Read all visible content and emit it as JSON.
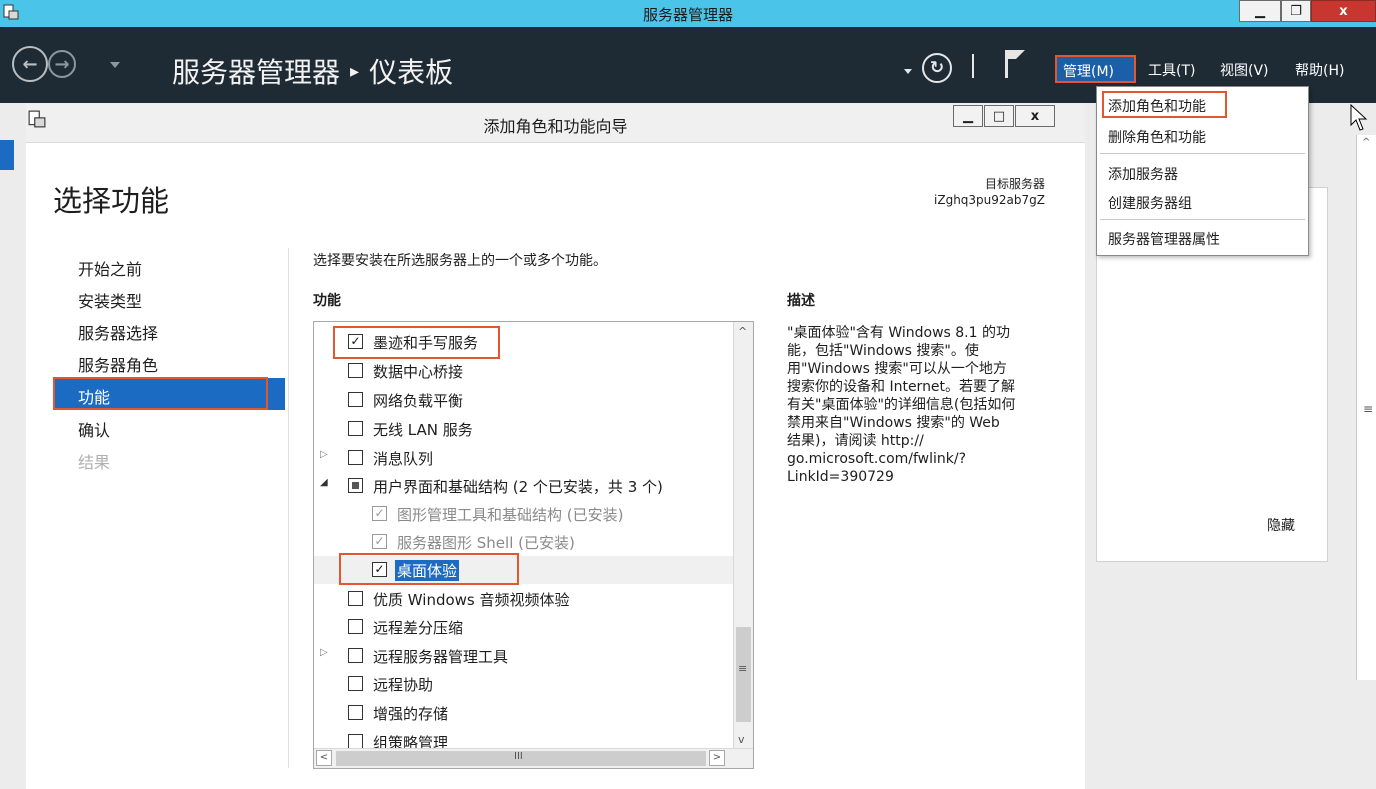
{
  "window": {
    "title": "服务器管理器",
    "minimize": "▁",
    "restore": "❐",
    "close": "x"
  },
  "header": {
    "breadcrumb_root": "服务器管理器",
    "breadcrumb_separator": "▸",
    "breadcrumb_current": "仪表板",
    "menus": {
      "manage": "管理(M)",
      "tools": "工具(T)",
      "view": "视图(V)",
      "help": "帮助(H)"
    }
  },
  "manage_menu": {
    "items": [
      "添加角色和功能",
      "删除角色和功能",
      "添加服务器",
      "创建服务器组",
      "服务器管理器属性"
    ]
  },
  "dialog": {
    "title": "添加角色和功能向导",
    "heading": "选择功能",
    "target_label": "目标服务器",
    "target_server": "iZghq3pu92ab7gZ",
    "steps": [
      "开始之前",
      "安装类型",
      "服务器选择",
      "服务器角色",
      "功能",
      "确认",
      "结果"
    ],
    "active_step": "功能",
    "intro": "选择要安装在所选服务器上的一个或多个功能。",
    "features_header": "功能",
    "description_header": "描述",
    "features": [
      {
        "label": "墨迹和手写服务",
        "state": "checked"
      },
      {
        "label": "数据中心桥接",
        "state": "unchecked"
      },
      {
        "label": "网络负载平衡",
        "state": "unchecked"
      },
      {
        "label": "无线 LAN 服务",
        "state": "unchecked"
      },
      {
        "label": "消息队列",
        "state": "unchecked",
        "expander": "collapsed"
      },
      {
        "label": "用户界面和基础结构 (2 个已安装，共 3 个)",
        "state": "partial",
        "expander": "expanded"
      },
      {
        "label": "图形管理工具和基础结构 (已安装)",
        "state": "installed"
      },
      {
        "label": "服务器图形 Shell (已安装)",
        "state": "installed"
      },
      {
        "label": "桌面体验",
        "state": "checked",
        "selected": true
      },
      {
        "label": "优质 Windows 音频视频体验",
        "state": "unchecked"
      },
      {
        "label": "远程差分压缩",
        "state": "unchecked"
      },
      {
        "label": "远程服务器管理工具",
        "state": "unchecked",
        "expander": "collapsed"
      },
      {
        "label": "远程协助",
        "state": "unchecked"
      },
      {
        "label": "增强的存储",
        "state": "unchecked"
      },
      {
        "label": "组策略管理",
        "state": "unchecked"
      }
    ],
    "description_lines": [
      "\"桌面体验\"含有 Windows 8.1 的功",
      "能，包括\"Windows 搜索\"。使",
      "用\"Windows 搜索\"可以从一个地方",
      "搜索你的设备和 Internet。若要了解",
      "有关\"桌面体验\"的详细信息(包括如何",
      "禁用来自\"Windows 搜索\"的 Web",
      "结果)，请阅读 http://",
      "go.microsoft.com/fwlink/?",
      "LinkId=390729"
    ]
  },
  "right_panel": {
    "hide_label": "隐藏"
  },
  "colors": {
    "title_bar": "#4bc4ea",
    "header_bg": "#1f2b34",
    "accent_blue": "#1a6bc1",
    "highlight_red": "#e4572e"
  }
}
